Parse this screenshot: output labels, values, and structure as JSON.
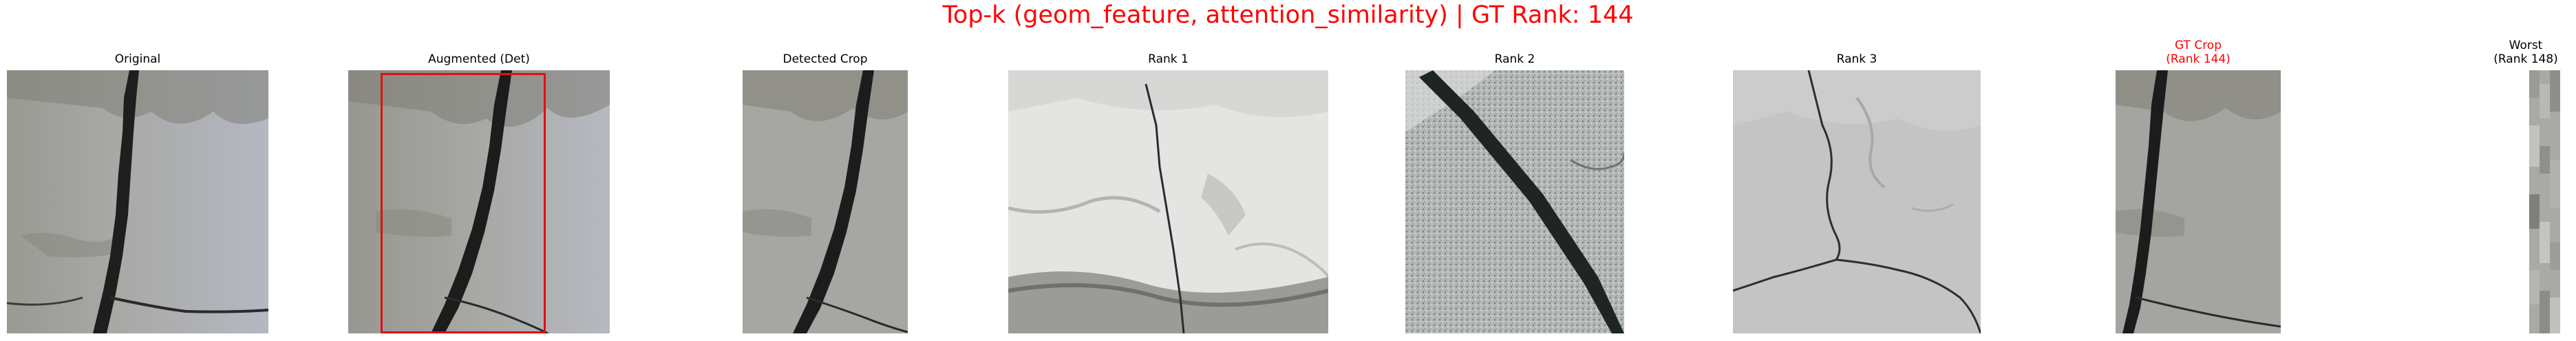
{
  "figure": {
    "title": "Top-k (geom_feature, attention_similarity) | GT Rank: 144",
    "title_color": "#ff0000"
  },
  "panels": [
    {
      "id": "original",
      "title": "Original",
      "image": "concrete-crack-vertical",
      "title_color": "#000000"
    },
    {
      "id": "augmented",
      "title": "Augmented (Det)",
      "image": "concrete-crack-vertical-augmented",
      "box_color": "#e01010",
      "title_color": "#000000"
    },
    {
      "id": "detected",
      "title": "Detected Crop",
      "image": "concrete-crack-vertical-crop",
      "title_color": "#000000"
    },
    {
      "id": "rank1",
      "title": "Rank 1",
      "image": "white-plaster-crack",
      "title_color": "#000000"
    },
    {
      "id": "rank2",
      "title": "Rank 2",
      "image": "diagonal-crack-speckled",
      "title_color": "#000000"
    },
    {
      "id": "rank3",
      "title": "Rank 3",
      "image": "branching-crack-grey",
      "title_color": "#000000"
    },
    {
      "id": "gt",
      "title_line1": "GT Crop",
      "title_line2": "(Rank 144)",
      "image": "concrete-crack-vertical-gt",
      "title_color": "#ff0000"
    },
    {
      "id": "worst",
      "title_line1": "Worst",
      "title_line2": "(Rank 148)",
      "image": "narrow-grey-strip",
      "title_color": "#000000"
    }
  ]
}
